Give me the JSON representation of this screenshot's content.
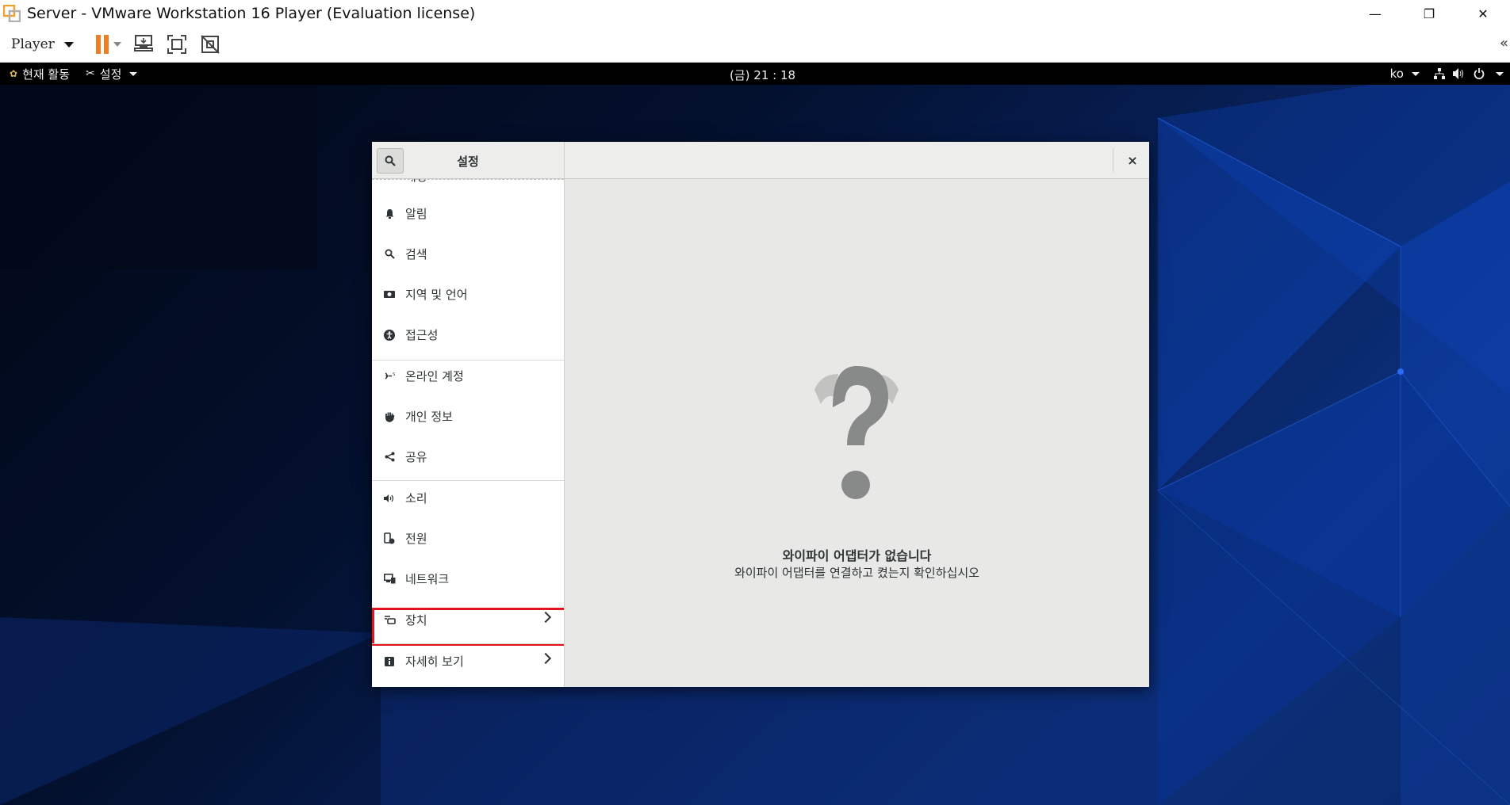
{
  "host": {
    "title": "Server - VMware Workstation 16 Player (Evaluation license)",
    "player_menu": "Player",
    "collapse_glyph": "«",
    "window_controls": {
      "minimize": "—",
      "restore": "❐",
      "close": "✕"
    },
    "icons": [
      "vmware-logo-icon",
      "pause-icon",
      "send-ctrl-alt-del-icon",
      "full-screen-icon",
      "unity-icon",
      "collapse-toolbar-icon"
    ],
    "accent": "#f07c24"
  },
  "guest_topbar": {
    "activities": "현재 활동",
    "app_menu": "설정",
    "clock": "(금) 21 : 18",
    "lang": "ko",
    "icons": [
      "network-icon",
      "volume-icon",
      "power-icon"
    ]
  },
  "settings": {
    "title": "설정",
    "close": "×",
    "partial_item": "배경",
    "items": [
      {
        "label": "알림",
        "icon": "bell-icon"
      },
      {
        "label": "검색",
        "icon": "search-icon"
      },
      {
        "label": "지역 및 언어",
        "icon": "region-icon"
      },
      {
        "label": "접근성",
        "icon": "accessibility-icon"
      },
      {
        "label": "온라인 계정",
        "icon": "online-accounts-icon"
      },
      {
        "label": "개인 정보",
        "icon": "privacy-icon"
      },
      {
        "label": "공유",
        "icon": "share-icon"
      },
      {
        "label": "소리",
        "icon": "sound-icon"
      },
      {
        "label": "전원",
        "icon": "power-icon"
      },
      {
        "label": "네트워크",
        "icon": "network-icon"
      },
      {
        "label": "장치",
        "icon": "devices-icon"
      },
      {
        "label": "자세히 보기",
        "icon": "info-icon"
      }
    ],
    "highlight_color": "#e3141c",
    "main": {
      "title": "와이파이 어댑터가 없습니다",
      "subtitle": "와이파이 어댑터를 연결하고 켰는지 확인하십시오",
      "icon": "question-mark-icon"
    }
  }
}
